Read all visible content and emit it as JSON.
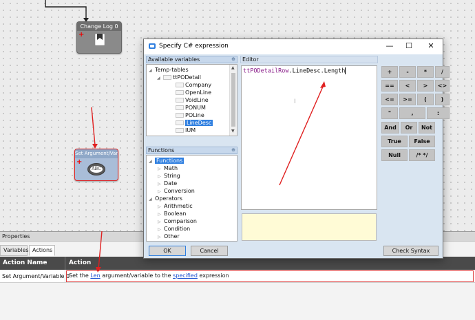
{
  "canvas": {
    "nodes": [
      {
        "title": "Change Log 0",
        "color": "#6e6e6e"
      },
      {
        "title": "Set Argument/Vari",
        "color": "#8fa8c8",
        "badge": "ABC"
      }
    ]
  },
  "dialog": {
    "title": "Specify C# expression",
    "controls": {
      "minimize": "—",
      "maximize": "☐",
      "close": "✕"
    },
    "variables": {
      "header": "Available variables",
      "items": [
        {
          "label": "Temp-tables",
          "level": 0,
          "expanded": true
        },
        {
          "label": "ttPODetail",
          "level": 1,
          "expanded": true
        },
        {
          "label": "Company",
          "level": 2
        },
        {
          "label": "OpenLine",
          "level": 2
        },
        {
          "label": "VoidLine",
          "level": 2
        },
        {
          "label": "PONUM",
          "level": 2
        },
        {
          "label": "POLine",
          "level": 2
        },
        {
          "label": "LineDesc",
          "level": 2,
          "selected": true
        },
        {
          "label": "IUM",
          "level": 2
        }
      ]
    },
    "functions": {
      "header": "Functions",
      "items": [
        {
          "label": "Functions",
          "level": 0,
          "selected": true
        },
        {
          "label": "Math",
          "level": 1
        },
        {
          "label": "String",
          "level": 1
        },
        {
          "label": "Date",
          "level": 1
        },
        {
          "label": "Conversion",
          "level": 1
        },
        {
          "label": "Operators",
          "level": 0
        },
        {
          "label": "Arithmetic",
          "level": 1
        },
        {
          "label": "Boolean",
          "level": 1
        },
        {
          "label": "Comparison",
          "level": 1
        },
        {
          "label": "Condition",
          "level": 1
        },
        {
          "label": "Other",
          "level": 1
        }
      ]
    },
    "editor": {
      "header": "Editor",
      "expr_object": "ttPODetailRow",
      "expr_member": ".LineDesc.Length"
    },
    "calculator": {
      "rows": [
        [
          "+",
          "-",
          "*",
          "/"
        ],
        [
          "==",
          "<",
          ">",
          "<>"
        ],
        [
          "<=",
          ">=",
          "(",
          ")"
        ],
        [
          "\"",
          ",",
          ":"
        ],
        [
          "And",
          "Or",
          "Not"
        ],
        [
          "True",
          "False"
        ],
        [
          "Null",
          "/* */"
        ]
      ]
    },
    "buttons": {
      "ok": "OK",
      "cancel": "Cancel",
      "check_syntax": "Check Syntax"
    }
  },
  "properties": {
    "header": "Properties",
    "tabs": [
      "Variables",
      "Actions"
    ],
    "active_tab": "Actions",
    "columns": [
      "Action Name",
      "Action"
    ],
    "row": {
      "name": "Set Argument/Variable 0",
      "pre": "Set the ",
      "link1": "Len",
      "mid": " argument/variable to the ",
      "link2": "specified",
      "post": " expression"
    }
  },
  "colors": {
    "accent": "#2f7fe0",
    "arrow": "#e02020",
    "keyword": "#8a1f8a"
  }
}
